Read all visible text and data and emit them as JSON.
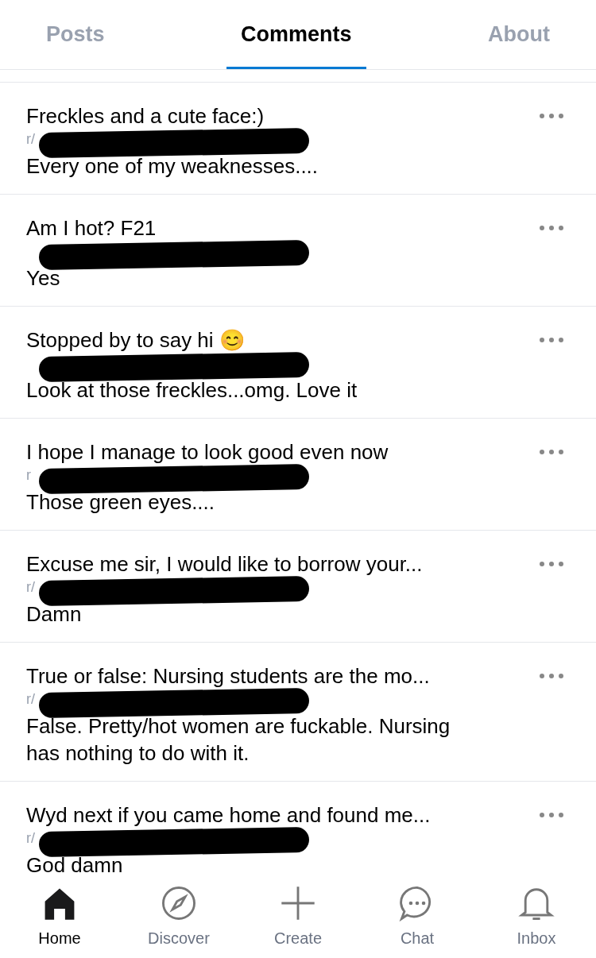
{
  "tabs": [
    {
      "label": "Posts",
      "selected": false
    },
    {
      "label": "Comments",
      "selected": true
    },
    {
      "label": "About",
      "selected": false
    }
  ],
  "comments": [
    {
      "title": "Freckles and a cute face:)",
      "meta": "r/",
      "body": "Every one of my weaknesses...."
    },
    {
      "title": "Am I hot? F21",
      "body": "Yes"
    },
    {
      "title": "Stopped by to say hi 😊",
      "body": "Look at those freckles...omg. Love it"
    },
    {
      "title": "I hope I manage to look good even now",
      "meta": "r",
      "body": "Those green eyes...."
    },
    {
      "title": "Excuse me sir, I would like to borrow your...",
      "meta": "r/",
      "body": "Damn"
    },
    {
      "title": "True or false: Nursing students are the mo...",
      "meta": "r/",
      "body": "False. Pretty/hot women are fuckable. Nursing has nothing to do with it."
    },
    {
      "title": "Wyd next if you came home and found me...",
      "meta": "r/",
      "body": "God damn"
    }
  ],
  "nav": [
    {
      "kind": "home",
      "label": "Home",
      "selected": true
    },
    {
      "kind": "discover",
      "label": "Discover",
      "selected": false
    },
    {
      "kind": "create",
      "label": "Create",
      "selected": false
    },
    {
      "kind": "chat",
      "label": "Chat",
      "selected": false
    },
    {
      "kind": "inbox",
      "label": "Inbox",
      "selected": false
    }
  ]
}
